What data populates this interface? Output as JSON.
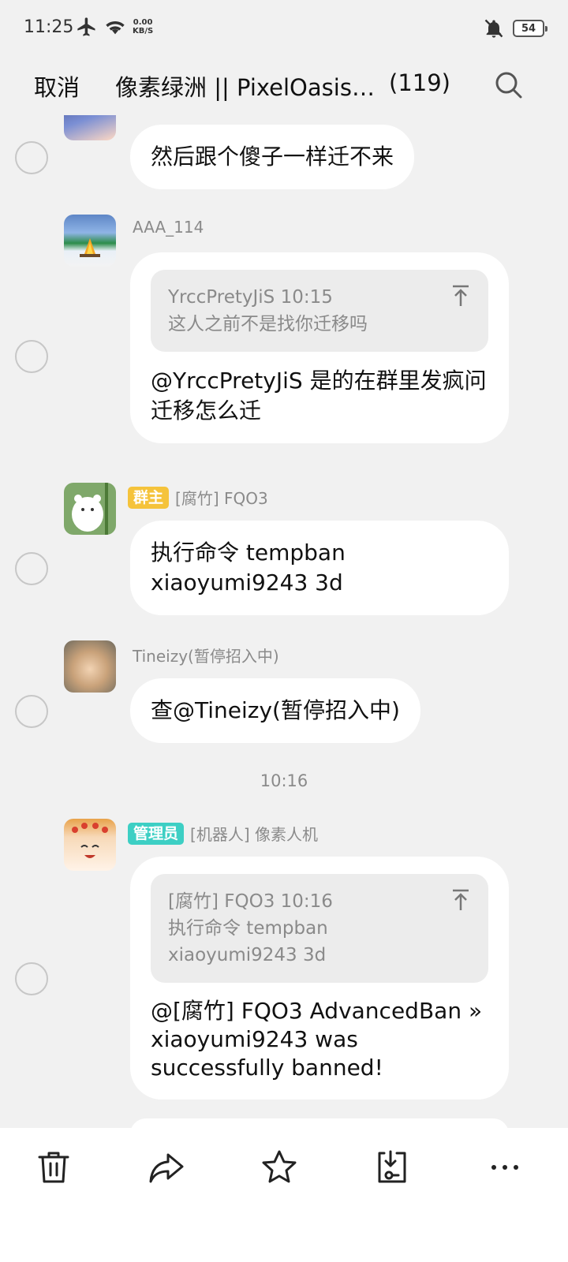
{
  "status": {
    "time": "11:25",
    "net_speed_value": "0.00",
    "net_speed_unit": "KB/S",
    "battery": "54",
    "icons": [
      "airplane-icon",
      "wifi-icon",
      "mute-icon",
      "battery-icon"
    ]
  },
  "header": {
    "cancel_label": "取消",
    "title": "像素绿洲 || PixelOasis玩...",
    "count": "(119)"
  },
  "messages": [
    {
      "text": "然后跟个傻子一样迁不来"
    },
    {
      "sender": "AAA_114",
      "quote": {
        "author": "YrccPretyJiS 10:15",
        "text": "这人之前不是找你迁移吗"
      },
      "text": "@YrccPretyJiS 是的在群里发疯问迁移怎么迁"
    },
    {
      "role": "群主",
      "role_color": "#f5c33b",
      "sender": "[腐竹] FQO3",
      "text": "执行命令 tempban xiaoyumi9243 3d"
    },
    {
      "sender": "Tineizy(暂停招入中)",
      "text": "查@Tineizy(暂停招入中)"
    },
    {
      "role": "管理员",
      "role_color": "#3dcfc4",
      "sender": "[机器人] 像素人机",
      "quote": {
        "author": "[腐竹] FQO3 10:16",
        "text": "执行命令 tempban xiaoyumi9243 3d"
      },
      "text": "@[腐竹] FQO3 AdvancedBan » xiaoyumi9243 was successfully banned!"
    }
  ],
  "time_divider": "10:16",
  "bottom_actions": [
    "delete-icon",
    "forward-icon",
    "favorite-icon",
    "save-icon",
    "more-icon"
  ]
}
